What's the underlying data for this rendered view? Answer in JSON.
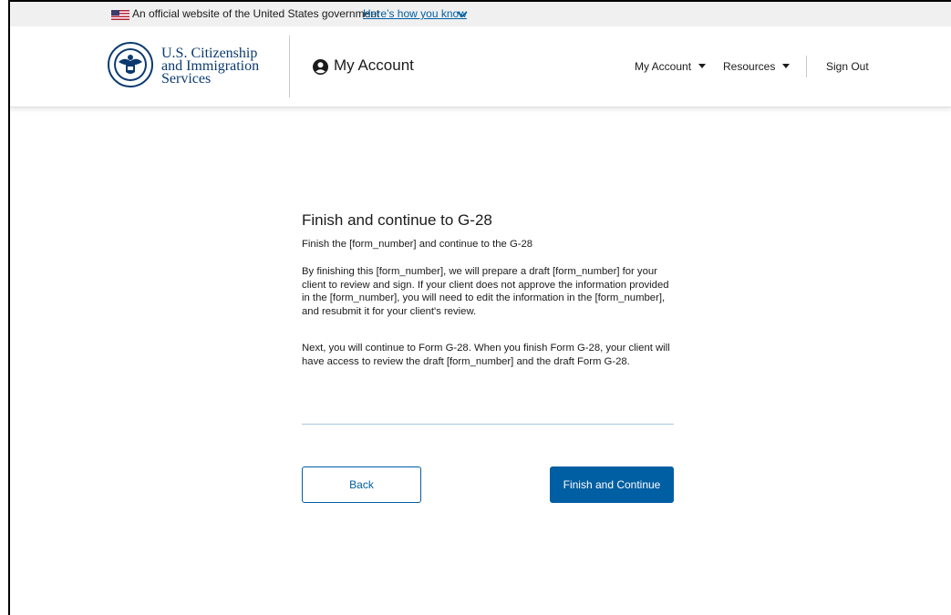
{
  "gov_banner": {
    "text": "An official website of the United States government",
    "link": "Here’s how you know",
    "flag_icon": "us-flag-icon",
    "chevron_icon": "chevron-down-icon"
  },
  "header": {
    "agency_line1": "U.S. Citizenship",
    "agency_line2": "and Immigration",
    "agency_line3": "Services",
    "seal_icon": "dhs-seal-icon",
    "account_title": "My Account",
    "account_icon": "user-circle-icon",
    "nav": {
      "my_account": "My Account",
      "resources": "Resources",
      "sign_out": "Sign Out"
    }
  },
  "main": {
    "title": "Finish and continue to G-28",
    "subtitle": "Finish the [form_number] and continue to the G-28",
    "paragraph1": "By finishing this [form_number], we will prepare a draft [form_number] for your client to review and sign. If your client does not approve the information provided in the [form_number], you will need to edit the information in the [form_number], and resubmit it for your client's review.",
    "paragraph2": "Next, you will continue to Form G-28. When you finish Form G-28, your client will have access to review the draft [form_number] and the draft Form G-28.",
    "back_label": "Back",
    "finish_label": "Finish and Continue"
  },
  "colors": {
    "primary": "#005ea2",
    "agency_text": "#0b3a70",
    "banner_bg": "#f0f0f0"
  }
}
